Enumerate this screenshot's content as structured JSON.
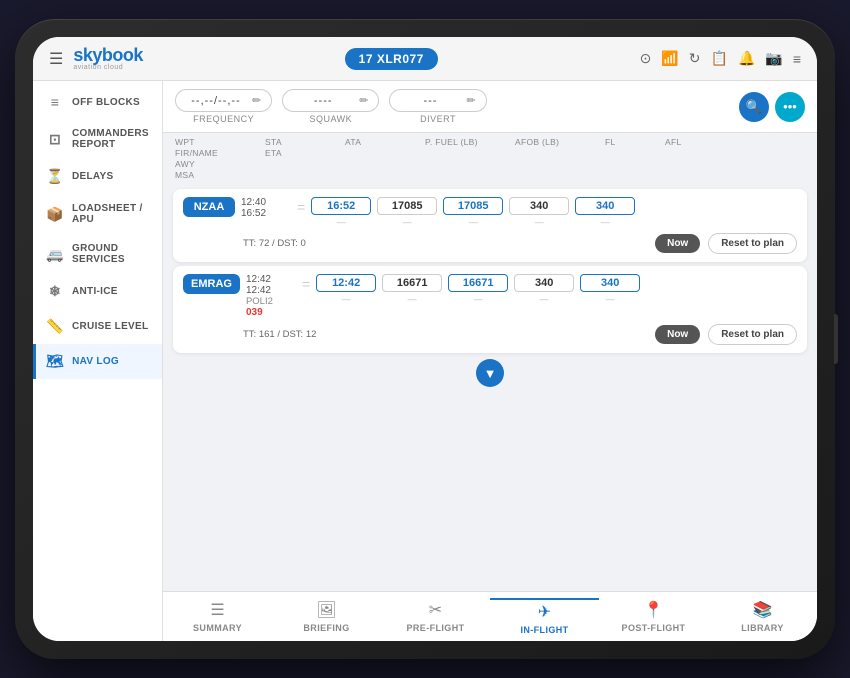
{
  "tablet": {
    "flight_id": "17 XLR077"
  },
  "topbar": {
    "brand": "skybook",
    "brand_sub": "aviation cloud",
    "icons": [
      "☁",
      "📶",
      "🔄",
      "📋",
      "🔔",
      "📷",
      "≡"
    ]
  },
  "sidebar": {
    "items": [
      {
        "id": "off-blocks",
        "icon": "≡",
        "label": "OFF BLOCKS",
        "active": false
      },
      {
        "id": "commanders-report",
        "icon": "⊡",
        "label": "COMMANDERS REPORT",
        "active": false
      },
      {
        "id": "delays",
        "icon": "⏳",
        "label": "DELAYS",
        "active": false
      },
      {
        "id": "loadsheet",
        "icon": "📦",
        "label": "LOADSHEET / APU",
        "active": false
      },
      {
        "id": "ground-services",
        "icon": "🚐",
        "label": "GROUND SERVICES",
        "active": false
      },
      {
        "id": "anti-ice",
        "icon": "❄",
        "label": "ANTI-ICE",
        "active": false
      },
      {
        "id": "cruise-level",
        "icon": "📏",
        "label": "CRUISE LEVEL",
        "active": false
      },
      {
        "id": "nav-log",
        "icon": "🗺",
        "label": "NAV LOG",
        "active": true
      }
    ]
  },
  "toolbar": {
    "frequency": {
      "value": "--,--/--,--",
      "label": "FREQUENCY"
    },
    "squawk": {
      "value": "----",
      "label": "SQUAWK"
    },
    "divert": {
      "value": "---",
      "label": "DIVERT"
    }
  },
  "table_header": {
    "cols": [
      "WPT\nFIR/NAME\nAWY\nMSA",
      "STA\nETA",
      "ATA",
      "P. FUEL (lb)",
      "AFOB (lb)",
      "FL",
      "AFL"
    ]
  },
  "entries": [
    {
      "id": "nzaa",
      "wpt": "NZAA",
      "sta": "12:40",
      "eta": "16:52",
      "ata_value": "16:52",
      "ata_sub": "",
      "p_fuel": "17085",
      "p_fuel_sub": "-",
      "afob": "17085",
      "afob_sub": "-",
      "fl": "340",
      "fl_sub": "-",
      "afl": "340",
      "afl_sub": "-",
      "tt": "TT: 72 / DST: 0",
      "btn_now": "Now",
      "btn_reset": "Reset to plan"
    },
    {
      "id": "emrag",
      "wpt": "EMRAG",
      "sta": "12:42",
      "eta": "12:42",
      "ata_value": "12:42",
      "ata_sub": "",
      "subtext": "POLI2",
      "red_text": "039",
      "p_fuel": "16671",
      "p_fuel_sub": "-",
      "afob": "16671",
      "afob_sub": "-",
      "fl": "340",
      "fl_sub": "-",
      "afl": "340",
      "afl_sub": "-",
      "tt": "TT: 161 / DST: 12",
      "btn_now": "Now",
      "btn_reset": "Reset to plan"
    }
  ],
  "bottom_nav": {
    "items": [
      {
        "id": "summary",
        "icon": "☰",
        "label": "SUMMARY",
        "active": false
      },
      {
        "id": "briefing",
        "icon": "🖼",
        "label": "BRIEFING",
        "active": false
      },
      {
        "id": "pre-flight",
        "icon": "✈",
        "label": "PRE-FLIGHT",
        "active": false
      },
      {
        "id": "in-flight",
        "icon": "✈",
        "label": "IN-FLIGHT",
        "active": true
      },
      {
        "id": "post-flight",
        "icon": "📍",
        "label": "POST-FLIGHT",
        "active": false
      },
      {
        "id": "library",
        "icon": "📚",
        "label": "LIBRARY",
        "active": false
      }
    ]
  }
}
